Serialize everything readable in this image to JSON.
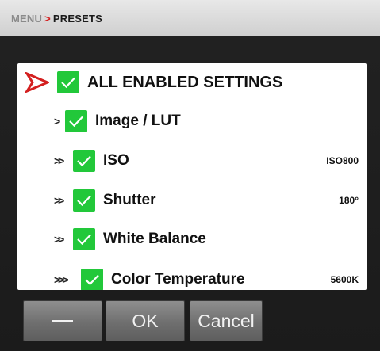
{
  "breadcrumb": {
    "root": "MENU",
    "separator": ">",
    "current": "PRESETS"
  },
  "settings": {
    "root": {
      "label": "ALL ENABLED SETTINGS",
      "checked": true,
      "marker_icon": "red-chevron-arrow-icon"
    },
    "items": [
      {
        "label": "Image / LUT",
        "level": 1,
        "chevrons": ">",
        "checked": true,
        "value": ""
      },
      {
        "label": "ISO",
        "level": 2,
        "chevrons": ">>",
        "checked": true,
        "value": "ISO800"
      },
      {
        "label": "Shutter",
        "level": 2,
        "chevrons": ">>",
        "checked": true,
        "value": "180°"
      },
      {
        "label": "White Balance",
        "level": 2,
        "chevrons": ">>",
        "checked": true,
        "value": ""
      },
      {
        "label": "Color Temperature",
        "level": 3,
        "chevrons": ">>>",
        "checked": true,
        "value": "5600K"
      }
    ]
  },
  "buttons": {
    "dash_icon": "minus-icon",
    "ok": "OK",
    "cancel": "Cancel"
  },
  "colors": {
    "accent_red": "#d42020",
    "check_green": "#22c83a"
  }
}
